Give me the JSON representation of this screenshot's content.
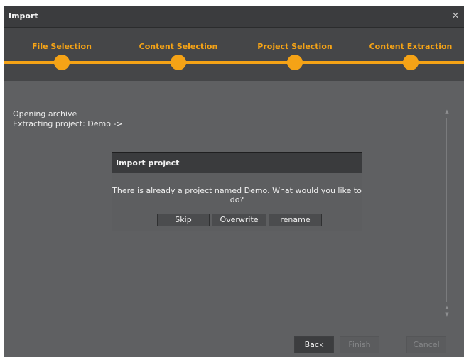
{
  "window": {
    "title": "Import",
    "close_label": "×"
  },
  "stepper": {
    "accent": "#f5a316",
    "steps": [
      {
        "label": "File Selection"
      },
      {
        "label": "Content Selection"
      },
      {
        "label": "Project Selection"
      },
      {
        "label": "Content Extraction"
      }
    ]
  },
  "log": {
    "lines": [
      "Opening archive",
      "Extracting project: Demo ->"
    ]
  },
  "scrollbar": {
    "up_arrow": "▲",
    "down_arrow": "▼"
  },
  "dialog": {
    "title": "Import project",
    "message": "There is already a project named Demo. What would you like to do?",
    "buttons": {
      "skip": "Skip",
      "overwrite": "Overwrite",
      "rename": "rename"
    }
  },
  "footer": {
    "back": "Back",
    "finish": "Finish",
    "cancel": "Cancel"
  }
}
